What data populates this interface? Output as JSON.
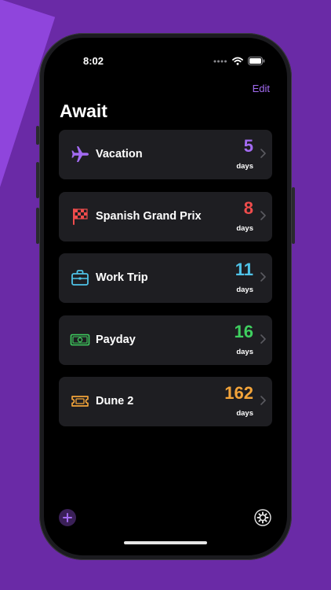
{
  "status_bar": {
    "time": "8:02"
  },
  "header": {
    "edit_label": "Edit",
    "title": "Await"
  },
  "colors": {
    "accent": "#a36bf2",
    "vacation": "#a36bf2",
    "spanish_gp": "#ef4c4c",
    "work_trip": "#4fc3e8",
    "payday": "#3fcf5f",
    "dune": "#f3a43a"
  },
  "events": [
    {
      "name": "Vacation",
      "count": "5",
      "unit": "days",
      "icon": "airplane-icon"
    },
    {
      "name": "Spanish Grand Prix",
      "count": "8",
      "unit": "days",
      "icon": "checkered-flag-icon"
    },
    {
      "name": "Work Trip",
      "count": "11",
      "unit": "days",
      "icon": "briefcase-icon"
    },
    {
      "name": "Payday",
      "count": "16",
      "unit": "days",
      "icon": "banknote-icon"
    },
    {
      "name": "Dune 2",
      "count": "162",
      "unit": "days",
      "icon": "ticket-icon"
    }
  ],
  "toolbar": {
    "add_icon": "plus-icon",
    "settings_icon": "gear-icon"
  }
}
